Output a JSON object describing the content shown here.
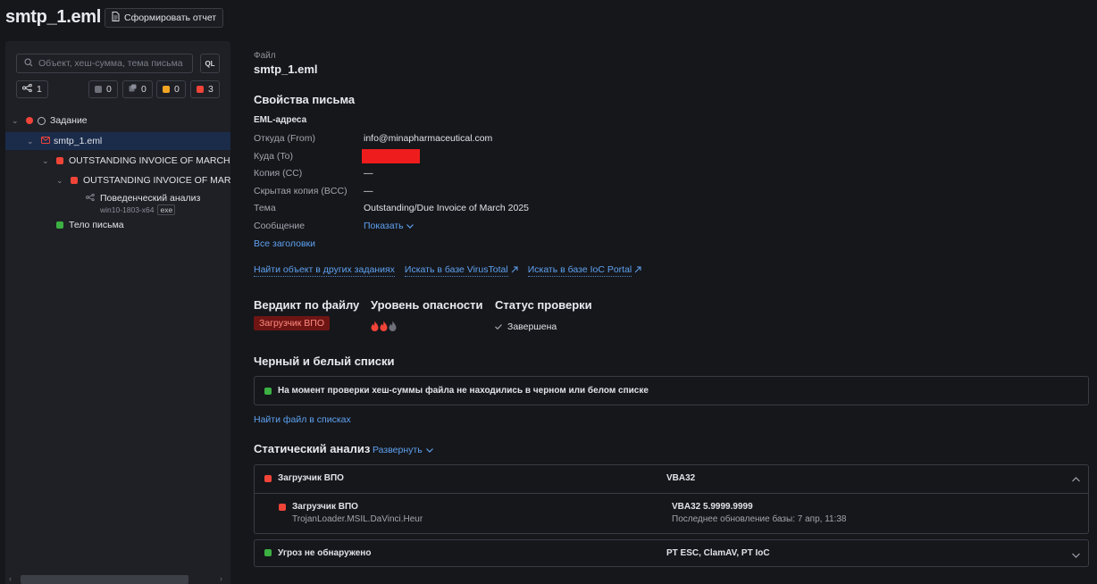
{
  "header": {
    "title": "smtp_1.eml",
    "report_label": "Сформировать отчет"
  },
  "sidebar": {
    "search_placeholder": "Объект, хеш-сумма, тема письма",
    "ql_label": "QL",
    "counters": {
      "links": "1",
      "gray": "0",
      "files": "0",
      "orange": "0",
      "red": "3"
    },
    "tree": {
      "task": "Задание",
      "eml": "smtp_1.eml",
      "attachment": "OUTSTANDING INVOICE OF MARCH.zi",
      "inner": "OUTSTANDING INVOICE OF MARCH",
      "behavior": "Поведенческий анализ",
      "behavior_env": "win10-1803-x64",
      "behavior_tag": "exe",
      "body": "Тело письма"
    },
    "colors": {
      "red": "#f04438",
      "orange": "#f5a524",
      "green": "#3cb043",
      "gray": "#8b8e98"
    }
  },
  "main": {
    "file_label": "Файл",
    "file_name": "smtp_1.eml",
    "props_title": "Свойства письма",
    "eml_addresses": "EML-адреса",
    "from_label": "Откуда (From)",
    "from_value": "info@minapharmaceutical.com",
    "to_label": "Куда (To)",
    "cc_label": "Копия (CC)",
    "cc_value": "—",
    "bcc_label": "Скрытая копия (BCC)",
    "bcc_value": "—",
    "subject_label": "Тема",
    "subject_value": "Outstanding/Due Invoice of March 2025",
    "message_label": "Сообщение",
    "message_show": "Показать",
    "all_headers": "Все заголовки",
    "links": {
      "find_other": "Найти объект в других заданиях",
      "virustotal": "Искать в базе VirusTotal",
      "ioc_portal": "Искать в базе IoC Portal"
    },
    "verdict_title": "Вердикт по файлу",
    "verdict_value": "Загрузчик ВПО",
    "danger_title": "Уровень опасности",
    "danger_level": 2,
    "danger_max": 3,
    "status_title": "Статус проверки",
    "status_value": "Завершена",
    "lists_title": "Черный и белый списки",
    "lists_message": "На момент проверки хеш-суммы файла не находились в черном или белом списке",
    "find_in_lists": "Найти файл в списках",
    "static_title": "Статический анализ",
    "expand_label": "Развернуть",
    "static": {
      "row1_name": "Загрузчик ВПО",
      "row1_engine": "VBA32",
      "detail_name": "Загрузчик ВПО",
      "detail_sig": "TrojanLoader.MSIL.DaVinci.Heur",
      "detail_engine": "VBA32 5.9999.9999",
      "detail_update": "Последнее обновление базы: 7 апр, 11:38",
      "row2_name": "Угроз не обнаружено",
      "row2_engines": "PT ESC, ClamAV, PT IoC"
    }
  }
}
